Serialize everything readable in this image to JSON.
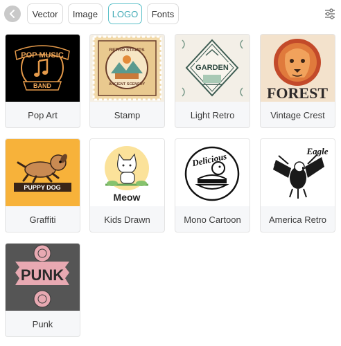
{
  "toolbar": {
    "tabs": [
      {
        "label": "Vector",
        "active": false
      },
      {
        "label": "Image",
        "active": false
      },
      {
        "label": "LOGO",
        "active": true
      },
      {
        "label": "Fonts",
        "active": false
      }
    ],
    "accent_color": "#5bc0c9"
  },
  "styles": [
    {
      "label": "Pop Art",
      "art_text": [
        "POP MUSIC",
        "BAND"
      ]
    },
    {
      "label": "Stamp",
      "art_text": [
        "RETRO STAMPS",
        "ANCIENT SCENERY"
      ]
    },
    {
      "label": "Light Retro",
      "art_text": [
        "GARDEN"
      ]
    },
    {
      "label": "Vintage Crest",
      "art_text": [
        "FOREST"
      ]
    },
    {
      "label": "Graffiti",
      "art_text": [
        "PUPPY DOG"
      ]
    },
    {
      "label": "Kids Drawn",
      "art_text": [
        "Meow"
      ]
    },
    {
      "label": "Mono Cartoon",
      "art_text": [
        "Delicious"
      ]
    },
    {
      "label": "America Retro",
      "art_text": [
        "Eagle"
      ]
    },
    {
      "label": "Punk",
      "art_text": [
        "PUNK"
      ]
    }
  ]
}
